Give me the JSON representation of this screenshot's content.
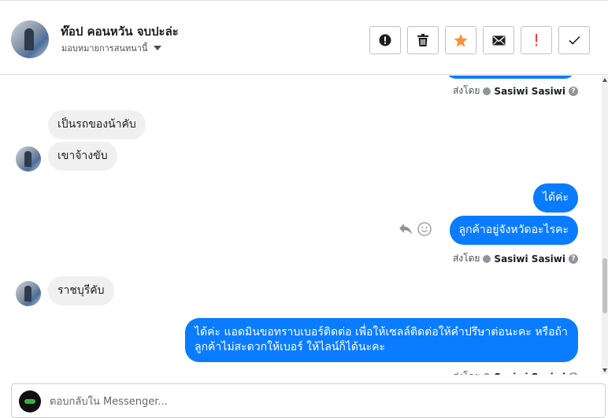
{
  "header": {
    "name": "ท๊อป คอนหวัน จบปะล่ะ",
    "assign_label": "มอบหมายการสนทนานี้"
  },
  "actions": [
    {
      "name": "spam-alert",
      "icon": "exclamation-circle-icon"
    },
    {
      "name": "delete",
      "icon": "trash-icon"
    },
    {
      "name": "star",
      "icon": "star-icon",
      "color": "#f7923b"
    },
    {
      "name": "mark-unread",
      "icon": "envelope-icon"
    },
    {
      "name": "follow-up",
      "icon": "exclamation-icon",
      "color": "#fa3e3e"
    },
    {
      "name": "done",
      "icon": "checkmark-icon"
    }
  ],
  "thread": {
    "sent_by_label": "ส่งโดย",
    "sender_name": "Sasiwi Sasiwi",
    "messages": [
      {
        "from": "customer",
        "text": "เป็นรถของน้าคับ"
      },
      {
        "from": "customer",
        "text": "เขาจ้างขับ"
      },
      {
        "from": "page",
        "text": "ได้ค่ะ"
      },
      {
        "from": "page",
        "text": "ลูกค้าอยู่จังหวัดอะไรคะ"
      },
      {
        "from": "customer",
        "text": "ราชบุรีคับ"
      },
      {
        "from": "page",
        "text": "ได้ค่ะ แอดมินขอทราบเบอร์ติดต่อ เพื่อให้เซลล์ติดต่อให้คำปรึษาต่อนะคะ หรือถ้าลูกค้าไม่สะดวกให้เบอร์ ให้ไลน์ก็ได้นะคะ"
      }
    ]
  },
  "composer": {
    "placeholder": "ตอบกลับใน Messenger..."
  },
  "colors": {
    "outgoing_bubble": "#0a7cff",
    "incoming_bubble": "#f1f0f0"
  }
}
